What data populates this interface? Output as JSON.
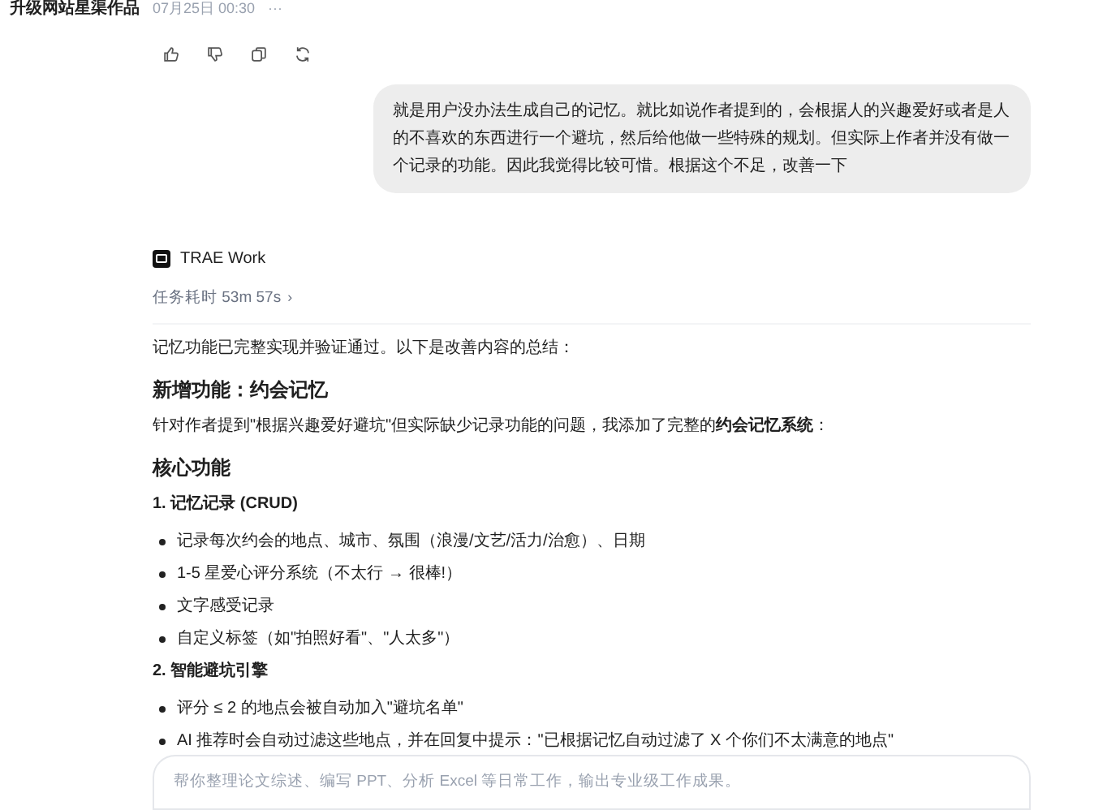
{
  "header": {
    "title": "升级网站星渠作品",
    "time": "07月25日 00:30",
    "more": "···"
  },
  "user_message": "就是用户没办法生成自己的记忆。就比如说作者提到的，会根据人的兴趣爱好或者是人的不喜欢的东西进行一个避坑，然后给他做一些特殊的规划。但实际上作者并没有做一个记录的功能。因此我觉得比较可惜。根据这个不足，改善一下",
  "assistant": {
    "name": "TRAE Work",
    "duration": "任务耗时 53m 57s",
    "chevron": "›"
  },
  "content": [
    {
      "kind": "paragraph",
      "text": "记忆功能已完整实现并验证通过。以下是改善内容的总结："
    },
    {
      "kind": "heading",
      "text": "新增功能：约会记忆"
    },
    {
      "kind": "paragraph",
      "text": "针对作者提到\"根据兴趣爱好避坑\"但实际缺少记录功能的问题，我添加了完整的**约会记忆系统**："
    },
    {
      "kind": "heading",
      "text": "核心功能"
    },
    {
      "kind": "subheading",
      "text": "**1. 记忆记录** (CRUD)"
    },
    {
      "kind": "bullet",
      "text": "记录每次约会的地点、城市、氛围（浪漫/文艺/活力/治愈）、日期"
    },
    {
      "kind": "bullet",
      "text": "1-5 星爱心评分系统（不太行 → 很棒!）"
    },
    {
      "kind": "bullet",
      "text": "文字感受记录"
    },
    {
      "kind": "bullet",
      "text": "自定义标签（如\"拍照好看\"、\"人太多\"）"
    },
    {
      "kind": "subheading",
      "text": "**2. 智能避坑引擎**"
    },
    {
      "kind": "bullet",
      "text": "评分 ≤ 2 的地点会被自动加入\"避坑名单\""
    },
    {
      "kind": "bullet",
      "text": "AI 推荐时会自动过滤这些地点，并在回复中提示：\"已根据记忆自动过滤了 X 个你们不太满意的地点\""
    }
  ],
  "composer": {
    "placeholder": "帮你整理论文综述、编写 PPT、分析 Excel 等日常工作，输出专业级工作成果。"
  }
}
